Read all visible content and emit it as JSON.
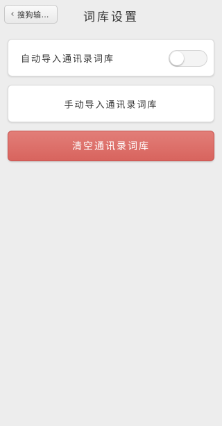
{
  "nav": {
    "back_label": "搜狗输…",
    "back_icon": "chevron-left",
    "title": "词库设置"
  },
  "auto_import": {
    "label": "自动导入通讯录词库",
    "enabled": false
  },
  "manual_import": {
    "label": "手动导入通讯录词库"
  },
  "clear": {
    "label": "清空通讯录词库",
    "color": "#dc6c66"
  }
}
